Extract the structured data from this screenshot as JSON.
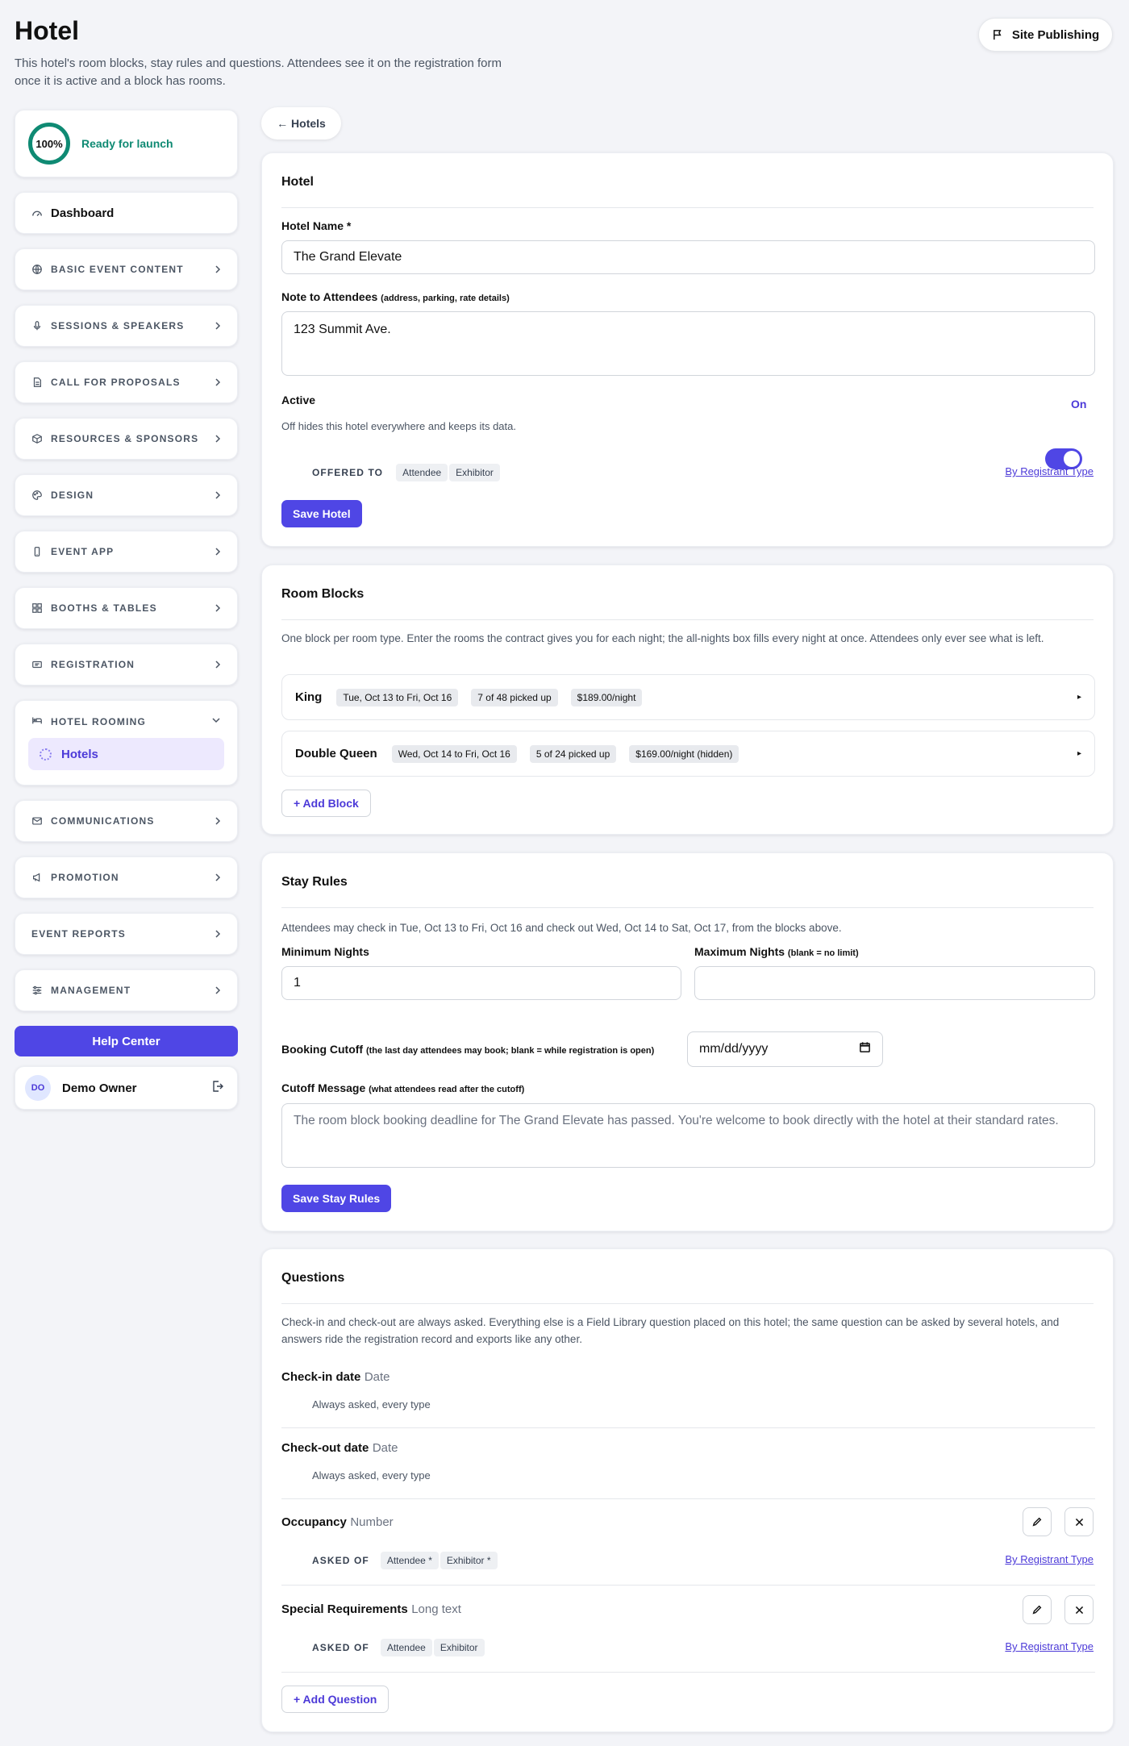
{
  "header": {
    "title": "Hotel",
    "description": "This hotel's room blocks, stay rules and questions. Attendees see it on the registration form once it is active and a block has rooms.",
    "site_publishing_label": "Site Publishing"
  },
  "sidebar": {
    "progress_value": "100%",
    "progress_label": "Ready for launch",
    "dashboard_label": "Dashboard",
    "items": [
      {
        "label": "BASIC EVENT CONTENT",
        "icon": "globe-icon"
      },
      {
        "label": "SESSIONS & SPEAKERS",
        "icon": "microphone-icon"
      },
      {
        "label": "CALL FOR PROPOSALS",
        "icon": "document-icon"
      },
      {
        "label": "RESOURCES & SPONSORS",
        "icon": "box-icon"
      },
      {
        "label": "DESIGN",
        "icon": "palette-icon"
      },
      {
        "label": "EVENT APP",
        "icon": "phone-icon"
      },
      {
        "label": "BOOTHS & TABLES",
        "icon": "grid-icon"
      },
      {
        "label": "REGISTRATION",
        "icon": "ticket-icon"
      }
    ],
    "hotel_group": {
      "label": "HOTEL ROOMING",
      "icon": "bed-icon",
      "sub_item": "Hotels"
    },
    "items_after": [
      {
        "label": "COMMUNICATIONS",
        "icon": "mail-icon"
      },
      {
        "label": "PROMOTION",
        "icon": "megaphone-icon"
      },
      {
        "label": "EVENT REPORTS",
        "icon": ""
      },
      {
        "label": "MANAGEMENT",
        "icon": "sliders-icon"
      }
    ],
    "help_label": "Help Center",
    "user": {
      "initials": "DO",
      "name": "Demo Owner"
    }
  },
  "back_label": "← Hotels",
  "hotel_panel": {
    "title": "Hotel",
    "name_label": "Hotel Name *",
    "name_value": "The Grand Elevate",
    "note_label": "Note to Attendees",
    "note_hint": "(address, parking, rate details)",
    "note_value": "123 Summit Ave.",
    "active_label": "Active",
    "active_state": "On",
    "active_help": "Off hides this hotel everywhere and keeps its data.",
    "offered_label": "OFFERED TO",
    "offered_types": [
      "Attendee",
      "Exhibitor"
    ],
    "registrant_link": "By Registrant Type",
    "save_label": "Save Hotel"
  },
  "blocks_panel": {
    "title": "Room Blocks",
    "description": "One block per room type. Enter the rooms the contract gives you for each night; the all-nights box fills every night at once. Attendees only ever see what is left.",
    "blocks": [
      {
        "name": "King",
        "dates": "Tue, Oct 13 to Fri, Oct 16",
        "picked": "7 of 48 picked up",
        "rate": "$189.00/night"
      },
      {
        "name": "Double Queen",
        "dates": "Wed, Oct 14 to Fri, Oct 16",
        "picked": "5 of 24 picked up",
        "rate": "$169.00/night (hidden)"
      }
    ],
    "add_label": "+ Add Block"
  },
  "stay_panel": {
    "title": "Stay Rules",
    "description": "Attendees may check in Tue, Oct 13 to Fri, Oct 16 and check out Wed, Oct 14 to Sat, Oct 17, from the blocks above.",
    "min_label": "Minimum Nights",
    "min_value": "1",
    "max_label": "Maximum Nights",
    "max_hint": "(blank = no limit)",
    "max_value": "",
    "cutoff_label": "Booking Cutoff",
    "cutoff_hint": "(the last day attendees may book; blank = while registration is open)",
    "cutoff_placeholder": "mm/dd/yyyy",
    "message_label": "Cutoff Message",
    "message_hint": "(what attendees read after the cutoff)",
    "message_placeholder": "The room block booking deadline for The Grand Elevate has passed. You're welcome to book directly with the hotel at their standard rates.",
    "save_label": "Save Stay Rules"
  },
  "questions_panel": {
    "title": "Questions",
    "description": "Check-in and check-out are always asked. Everything else is a Field Library question placed on this hotel; the same question can be asked by several hotels, and answers ride the registration record and exports like any other.",
    "questions": [
      {
        "title": "Check-in date",
        "type": "Date",
        "note": "Always asked, every type"
      },
      {
        "title": "Check-out date",
        "type": "Date",
        "note": "Always asked, every type"
      },
      {
        "title": "Occupancy",
        "type": "Number",
        "asked_label": "ASKED OF",
        "types": [
          "Attendee *",
          "Exhibitor *"
        ],
        "link": "By Registrant Type"
      },
      {
        "title": "Special Requirements",
        "type": "Long text",
        "asked_label": "ASKED OF",
        "types": [
          "Attendee",
          "Exhibitor"
        ],
        "link": "By Registrant Type"
      }
    ],
    "add_label": "+ Add Question"
  },
  "colors": {
    "accent": "#4f46e5",
    "success": "#0f8a73",
    "background": "#f3f4f8"
  }
}
